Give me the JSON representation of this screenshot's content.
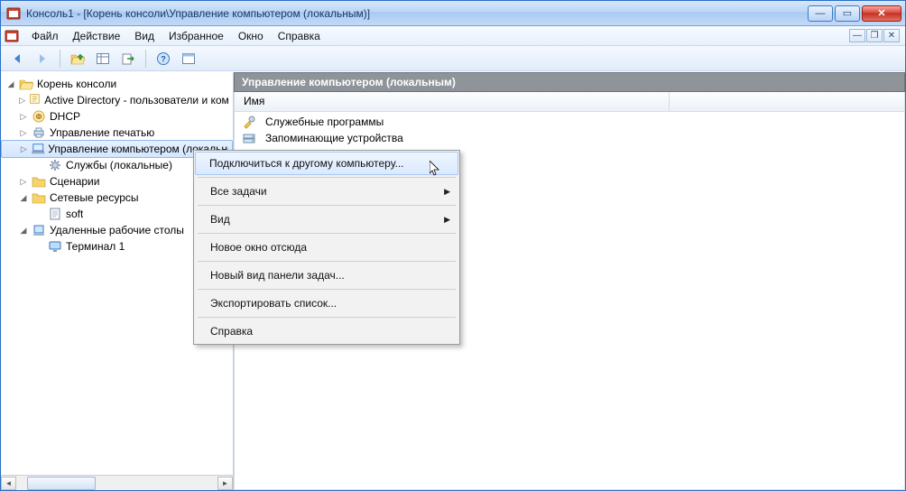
{
  "window": {
    "title": "Консоль1 - [Корень консоли\\Управление компьютером (локальным)]"
  },
  "menubar": {
    "items": [
      "Файл",
      "Действие",
      "Вид",
      "Избранное",
      "Окно",
      "Справка"
    ]
  },
  "tree": {
    "root": {
      "label": "Корень консоли"
    },
    "items": [
      {
        "label": "Active Directory - пользователи и компьютеры",
        "icon": "ad"
      },
      {
        "label": "DHCP",
        "icon": "dhcp"
      },
      {
        "label": "Управление печатью",
        "icon": "print"
      },
      {
        "label": "Управление компьютером (локальным)",
        "icon": "pc",
        "selected": true
      },
      {
        "label": "Службы (локальные)",
        "icon": "gear",
        "indent": 1
      },
      {
        "label": "Сценарии",
        "icon": "folder"
      },
      {
        "label": "Сетевые ресурсы",
        "icon": "folder",
        "expanded": true
      },
      {
        "label": "soft",
        "icon": "doc",
        "indent": 1
      },
      {
        "label": "Удаленные рабочие столы",
        "icon": "rdp",
        "expanded": true
      },
      {
        "label": "Терминал 1",
        "icon": "monitor",
        "indent": 1
      }
    ]
  },
  "content": {
    "header": "Управление компьютером (локальным)",
    "column": "Имя",
    "rows": [
      {
        "label": "Служебные программы",
        "icon": "tools"
      },
      {
        "label": "Запоминающие устройства",
        "icon": "storage"
      }
    ]
  },
  "context_menu": {
    "items": [
      {
        "label": "Подключиться к другому компьютеру...",
        "highlight": true
      },
      {
        "sep": true
      },
      {
        "label": "Все задачи",
        "submenu": true
      },
      {
        "sep": true
      },
      {
        "label": "Вид",
        "submenu": true
      },
      {
        "sep": true
      },
      {
        "label": "Новое окно отсюда"
      },
      {
        "sep": true
      },
      {
        "label": "Новый вид панели задач..."
      },
      {
        "sep": true
      },
      {
        "label": "Экспортировать список..."
      },
      {
        "sep": true
      },
      {
        "label": "Справка"
      }
    ]
  }
}
